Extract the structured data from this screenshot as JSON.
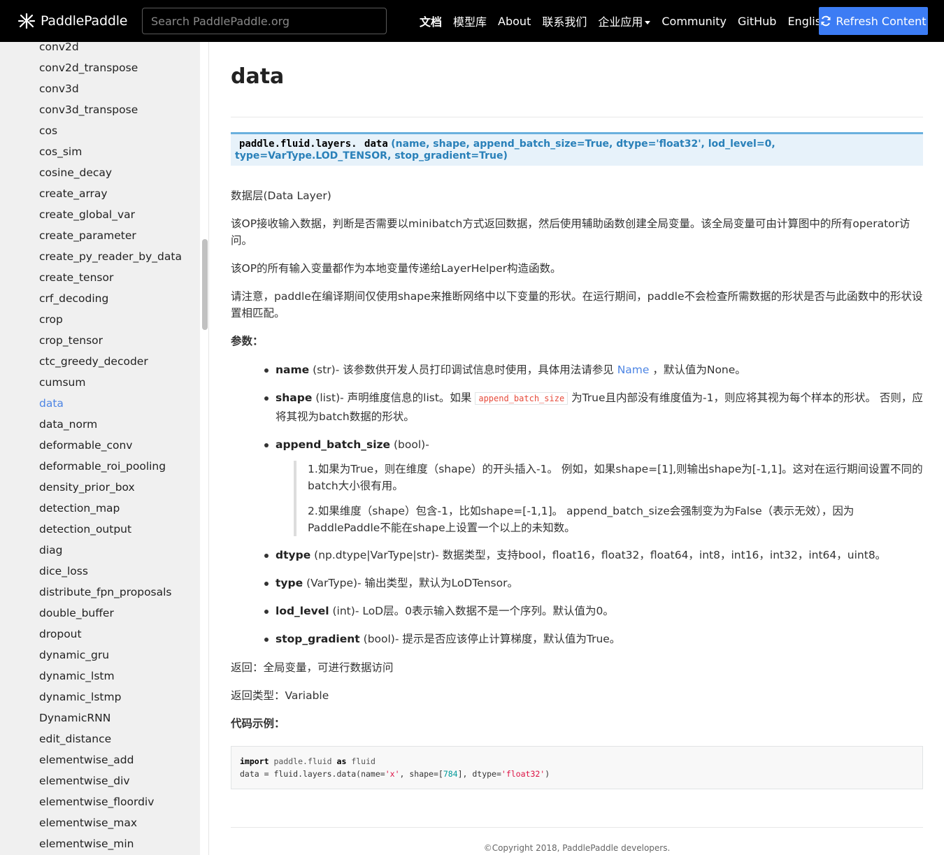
{
  "navbar": {
    "brand": "PaddlePaddle",
    "search_placeholder": "Search PaddlePaddle.org",
    "links": [
      "文档",
      "模型库",
      "About",
      "联系我们",
      "企业应用",
      "Community",
      "GitHub",
      "English"
    ],
    "refresh_label": "Refresh Content",
    "accent_color": "#3c7cf4"
  },
  "sidebar": {
    "items": [
      "conv2d",
      "conv2d_transpose",
      "conv3d",
      "conv3d_transpose",
      "cos",
      "cos_sim",
      "cosine_decay",
      "create_array",
      "create_global_var",
      "create_parameter",
      "create_py_reader_by_data",
      "create_tensor",
      "crf_decoding",
      "crop",
      "crop_tensor",
      "ctc_greedy_decoder",
      "cumsum",
      "data",
      "data_norm",
      "deformable_conv",
      "deformable_roi_pooling",
      "density_prior_box",
      "detection_map",
      "detection_output",
      "diag",
      "dice_loss",
      "distribute_fpn_proposals",
      "double_buffer",
      "dropout",
      "dynamic_gru",
      "dynamic_lstm",
      "dynamic_lstmp",
      "DynamicRNN",
      "edit_distance",
      "elementwise_add",
      "elementwise_div",
      "elementwise_floordiv",
      "elementwise_max",
      "elementwise_min"
    ],
    "active_item": "data"
  },
  "main": {
    "title": "data",
    "signature": {
      "module": "paddle.fluid.layers.",
      "name": "data",
      "params": "(name, shape, append_batch_size=True, dtype='float32', lod_level=0, type=VarType.LOD_TENSOR, stop_gradient=True)"
    },
    "p1": "数据层(Data Layer)",
    "p2": "该OP接收输入数据，判断是否需要以minibatch方式返回数据，然后使用辅助函数创建全局变量。该全局变量可由计算图中的所有operator访问。",
    "p3": "该OP的所有输入变量都作为本地变量传递给LayerHelper构造函数。",
    "p4": "请注意，paddle在编译期间仅使用shape来推断网络中以下变量的形状。在运行期间，paddle不会检查所需数据的形状是否与此函数中的形状设置相匹配。",
    "params_label": "参数：",
    "params": {
      "name": {
        "name": "name",
        "type": "(str)",
        "desc_pre": "- 该参数供开发人员打印调试信息时使用，具体用法请参见 ",
        "link": "Name",
        "desc_post": " ，默认值为None。"
      },
      "shape": {
        "name": "shape",
        "type": "(list)",
        "desc_pre": "- 声明维度信息的list。如果 ",
        "code": "append_batch_size",
        "desc_post": " 为True且内部没有维度值为-1，则应将其视为每个样本的形状。 否则，应将其视为batch数据的形状。"
      },
      "append": {
        "name": "append_batch_size",
        "type": "(bool)",
        "desc": "-",
        "q1": "1.如果为True，则在维度（shape）的开头插入-1。 例如，如果shape=[1],则输出shape为[-1,1]。这对在运行期间设置不同的batch大小很有用。",
        "q2": "2.如果维度（shape）包含-1，比如shape=[-1,1]。 append_batch_size会强制变为为False（表示无效），因为PaddlePaddle不能在shape上设置一个以上的未知数。"
      },
      "dtype": {
        "name": "dtype",
        "type": "(np.dtype|VarType|str)",
        "desc": "- 数据类型，支持bool，float16，float32，float64，int8，int16，int32，int64，uint8。"
      },
      "type": {
        "name": "type",
        "type": "(VarType)",
        "desc": "- 输出类型，默认为LoDTensor。"
      },
      "lod": {
        "name": "lod_level",
        "type": "(int)",
        "desc": "- LoD层。0表示输入数据不是一个序列。默认值为0。"
      },
      "stop": {
        "name": "stop_gradient",
        "type": "(bool)",
        "desc": "- 提示是否应该停止计算梯度，默认值为True。"
      }
    },
    "returns": "返回：全局变量，可进行数据访问",
    "return_type": "返回类型：Variable",
    "example_label": "代码示例：",
    "code": {
      "l1_kw1": "import",
      "l1_mod": "paddle.fluid",
      "l1_kw2": "as",
      "l1_alias": "fluid",
      "l2_a": "data = fluid.layers.data(name=",
      "l2_s1": "'x'",
      "l2_b": ", shape=[",
      "l2_n": "784",
      "l2_c": "], dtype=",
      "l2_s2": "'float32'",
      "l2_d": ")"
    },
    "footer": "©Copyright 2018, PaddlePaddle developers."
  }
}
